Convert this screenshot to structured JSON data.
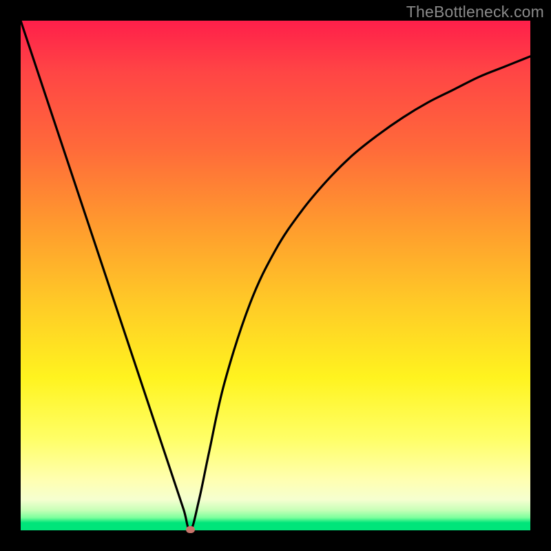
{
  "watermark": "TheBottleneck.com",
  "chart_data": {
    "type": "line",
    "title": "",
    "xlabel": "",
    "ylabel": "",
    "xlim": [
      0,
      1
    ],
    "ylim": [
      0,
      1
    ],
    "series": [
      {
        "name": "bottleneck-curve",
        "x": [
          0.0,
          0.05,
          0.1,
          0.15,
          0.2,
          0.25,
          0.28,
          0.3,
          0.32,
          0.333,
          0.35,
          0.37,
          0.4,
          0.45,
          0.5,
          0.55,
          0.6,
          0.65,
          0.7,
          0.75,
          0.8,
          0.85,
          0.9,
          0.95,
          1.0
        ],
        "y": [
          1.0,
          0.85,
          0.7,
          0.55,
          0.4,
          0.25,
          0.16,
          0.1,
          0.04,
          0.0,
          0.06,
          0.155,
          0.29,
          0.445,
          0.55,
          0.625,
          0.685,
          0.735,
          0.775,
          0.81,
          0.84,
          0.865,
          0.89,
          0.91,
          0.93
        ]
      }
    ],
    "annotations": [
      {
        "name": "minimum-marker",
        "x": 0.333,
        "y": 0.0
      }
    ],
    "background_gradient": {
      "top": "#ff1f4a",
      "mid1": "#ff9a2e",
      "mid2": "#fff31f",
      "bottom": "#00e57a"
    }
  }
}
